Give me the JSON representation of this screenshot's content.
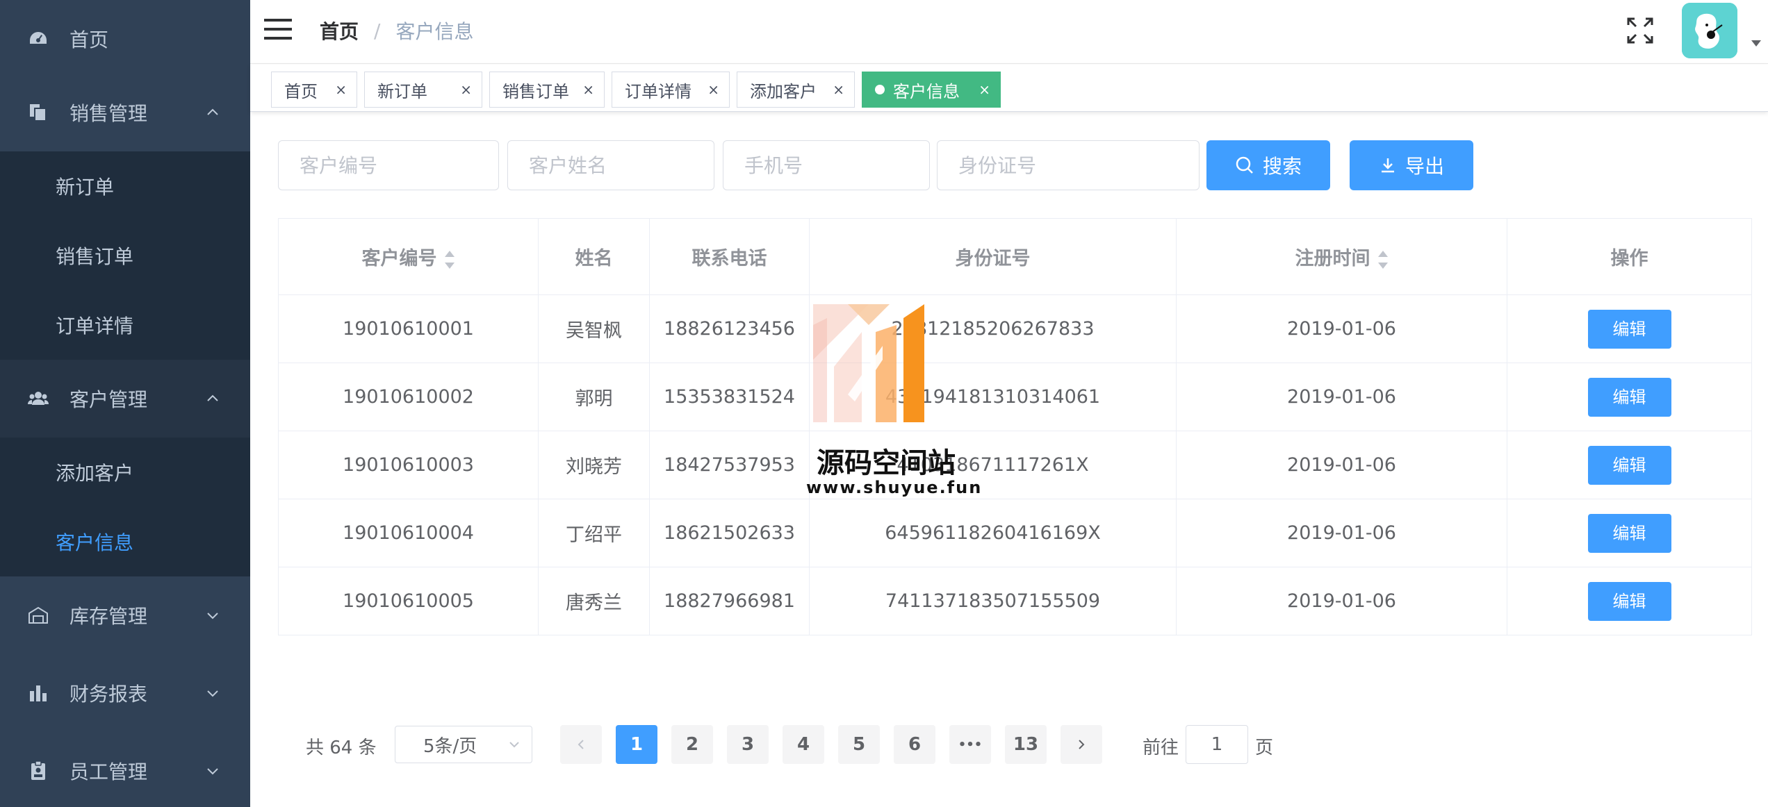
{
  "sidebar": {
    "menu": {
      "home": "首页",
      "sales": "销售管理",
      "customers": "客户管理",
      "inventory": "库存管理",
      "finance": "财务报表",
      "staff": "员工管理"
    },
    "sales_sub": [
      "新订单",
      "销售订单",
      "订单详情"
    ],
    "customers_sub": [
      "添加客户",
      "客户信息"
    ],
    "active_sub": "客户信息"
  },
  "header": {
    "breadcrumb": [
      "首页",
      "客户信息"
    ],
    "separator": "/"
  },
  "tags": [
    {
      "label": "首页",
      "close": "×"
    },
    {
      "label": "新订单",
      "close": "×"
    },
    {
      "label": "销售订单",
      "close": "×"
    },
    {
      "label": "订单详情",
      "close": "×"
    },
    {
      "label": "添加客户",
      "close": "×"
    },
    {
      "label": "客户信息",
      "close": "×",
      "active": true
    }
  ],
  "filters": {
    "customer_id_placeholder": "客户编号",
    "name_placeholder": "客户姓名",
    "phone_placeholder": "手机号",
    "id_card_placeholder": "身份证号",
    "search_label": "搜索",
    "export_label": "导出"
  },
  "table": {
    "columns": [
      "客户编号",
      "姓名",
      "联系电话",
      "身份证号",
      "注册时间",
      "操作"
    ],
    "edit_label": "编辑",
    "rows": [
      {
        "id": "19010610001",
        "name": "吴智枫",
        "phone": "18826123456",
        "idcard": "26812185206267833",
        "date": "2019-01-06"
      },
      {
        "id": "19010610002",
        "name": "郭明",
        "phone": "15353831524",
        "idcard": "437194181310314061",
        "date": "2019-01-06"
      },
      {
        "id": "19010610003",
        "name": "刘晓芳",
        "phone": "18427537953",
        "idcard": "410318671117261X",
        "date": "2019-01-06"
      },
      {
        "id": "19010610004",
        "name": "丁绍平",
        "phone": "18621502633",
        "idcard": "64596118260416169X",
        "date": "2019-01-06"
      },
      {
        "id": "19010610005",
        "name": "唐秀兰",
        "phone": "18827966981",
        "idcard": "741137183507155509",
        "date": "2019-01-06"
      }
    ]
  },
  "watermark": {
    "name": "源码空间站",
    "url": "www.shuyue.fun"
  },
  "pagination": {
    "total": "共 64 条",
    "page_size": "5条/页",
    "pages": [
      "1",
      "2",
      "3",
      "4",
      "5",
      "6",
      "•••",
      "13"
    ],
    "current": "1",
    "goto_prefix": "前往",
    "goto_value": "1",
    "goto_suffix": "页"
  },
  "colors": {
    "sidebar_bg": "#304156",
    "submenu_bg": "#1f2d3d",
    "primary": "#409eff",
    "active_tag": "#42b983"
  }
}
